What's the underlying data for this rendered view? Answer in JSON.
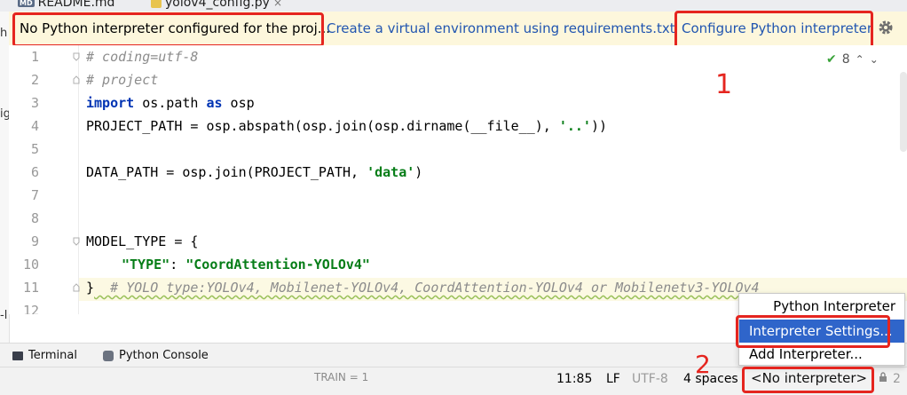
{
  "tabs": [
    {
      "badge": "MD",
      "label": "README.md"
    },
    {
      "label": "yolov4_config.py"
    }
  ],
  "left_edge": [
    "h",
    "ig",
    "-l"
  ],
  "notification": {
    "message": "No Python interpreter configured for the proj...",
    "link_create_venv": "Create a virtual environment using requirements.txt",
    "link_configure": "Configure Python interpreter"
  },
  "callouts": {
    "one": "1",
    "two": "2"
  },
  "inspections": {
    "count": "8"
  },
  "editor": {
    "line_numbers": [
      "1",
      "2",
      "3",
      "4",
      "5",
      "6",
      "7",
      "8",
      "9",
      "10",
      "11",
      "12"
    ],
    "lines": {
      "l1": "# coding=utf-8",
      "l2": "# project",
      "l3_kw1": "import",
      "l3_mid": " os.path ",
      "l3_kw2": "as",
      "l3_end": " osp",
      "l4_a": "PROJECT_PATH = osp.abspath(osp.join(osp.dirname(__file__), ",
      "l4_str": "'..'",
      "l4_b": "))",
      "l6_a": "DATA_PATH = osp.join(PROJECT_PATH, ",
      "l6_str": "'data'",
      "l6_b": ")",
      "l9": "MODEL_TYPE = {",
      "l10_key": "\"TYPE\"",
      "l10_sep": ": ",
      "l10_val": "\"CoordAttention-YOLOv4\"",
      "l11_brace": "}",
      "l11_comment": "  # YOLO type:YOLOv4, Mobilenet-YOLOv4, CoordAttention-YOLOv4 or Mobilenetv3-YOLOv4"
    }
  },
  "tool_windows": {
    "terminal": "Terminal",
    "python_console": "Python Console"
  },
  "status_bar": {
    "position": "11:85",
    "line_sep": "LF",
    "encoding": "UTF-8",
    "indent": "4 spaces",
    "interpreter": "<No interpreter>",
    "trailing": "2"
  },
  "behind_text": "TRAIN = 1",
  "interpreter_popup": {
    "header": "Python Interpreter",
    "items": [
      "Interpreter Settings...",
      "Add Interpreter..."
    ]
  },
  "colors": {
    "accent": "#2f65ca",
    "annotation": "#e5251f",
    "link": "#2155b0",
    "notify_bg": "#fdf7dc"
  }
}
